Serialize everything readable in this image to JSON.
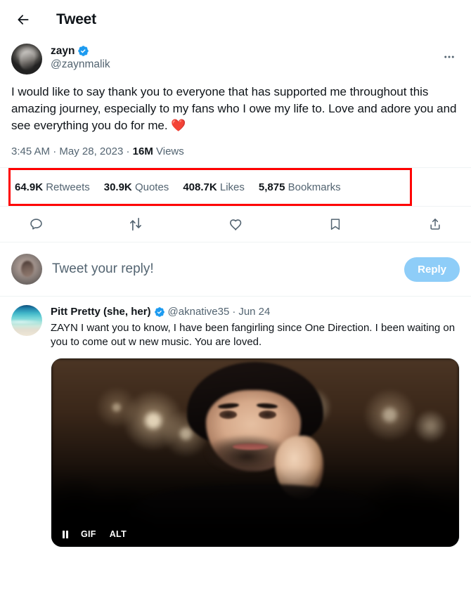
{
  "header": {
    "back_icon": "arrow-left-icon",
    "title": "Tweet"
  },
  "main_tweet": {
    "author": {
      "display_name": "zayn",
      "handle": "@zaynmalik",
      "verified": true,
      "verified_badge_color": "#1d9bf0",
      "avatar_alt": "zayn-profile-photo"
    },
    "more_icon": "more-horizontal-icon",
    "text": "I would like to say thank you to everyone that has supported me throughout this amazing journey, especially to my fans who I owe my life to. Love and adore you and see everything you do for me. ",
    "emoji": "❤️",
    "timestamp": "3:45 AM",
    "separator": "·",
    "date": "May 28, 2023",
    "views_count": "16M",
    "views_label": "Views",
    "stats": [
      {
        "value": "64.9K",
        "label": "Retweets",
        "name": "retweets-stat"
      },
      {
        "value": "30.9K",
        "label": "Quotes",
        "name": "quotes-stat"
      },
      {
        "value": "408.7K",
        "label": "Likes",
        "name": "likes-stat"
      },
      {
        "value": "5,875",
        "label": "Bookmarks",
        "name": "bookmarks-stat"
      }
    ],
    "actions": [
      {
        "name": "reply-action-icon",
        "icon": "comment-icon"
      },
      {
        "name": "retweet-action-icon",
        "icon": "retweet-icon"
      },
      {
        "name": "like-action-icon",
        "icon": "heart-icon"
      },
      {
        "name": "bookmark-action-icon",
        "icon": "bookmark-icon"
      },
      {
        "name": "share-action-icon",
        "icon": "share-upload-icon"
      }
    ]
  },
  "highlight": {
    "color": "#ff0000",
    "target": "stats-row"
  },
  "composer": {
    "avatar_alt": "current-user-avatar",
    "placeholder": "Tweet your reply!",
    "value": "",
    "reply_label": "Reply",
    "reply_button_color": "#8ecdf8"
  },
  "reply_tweet": {
    "author": {
      "display_name": "Pitt Pretty (she, her)",
      "handle": "@aknative35",
      "verified": true,
      "avatar_alt": "beach-avatar"
    },
    "separator": "·",
    "date": "Jun 24",
    "more_icon": "more-horizontal-icon",
    "text": "ZAYN I want you to know, I have been fangirling  since One Direction. I been waiting on you to come out w new music. You are loved.",
    "media": {
      "type": "gif",
      "alt_available": true,
      "badges": {
        "pause": "pause-icon",
        "gif": "GIF",
        "alt": "ALT"
      }
    }
  }
}
